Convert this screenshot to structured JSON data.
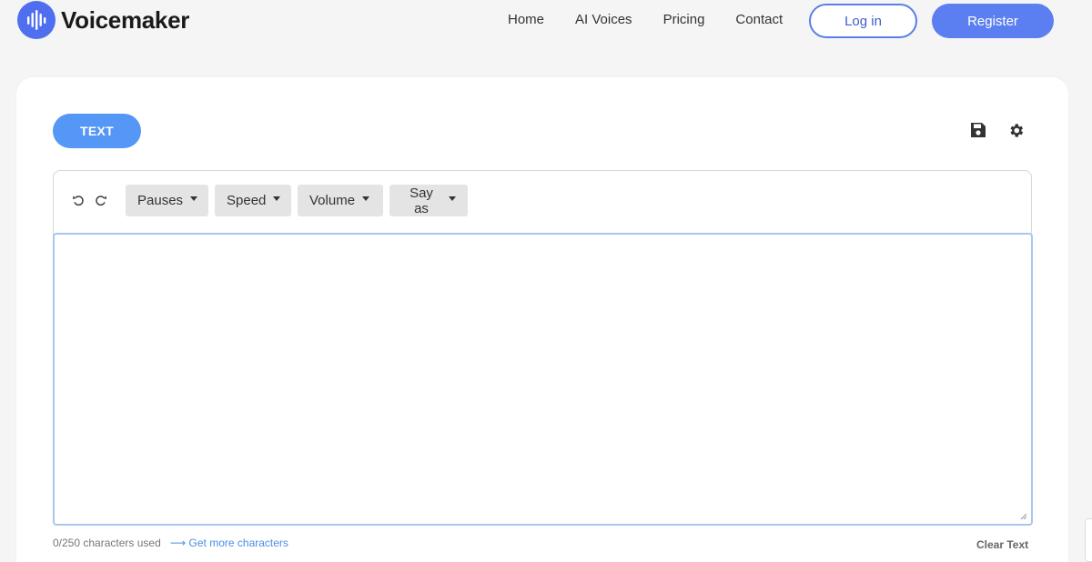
{
  "brand": {
    "name": "Voicemaker",
    "logo_icon": "soundwave-icon",
    "accent": "#4f6ff0"
  },
  "nav": {
    "items": [
      {
        "label": "Home"
      },
      {
        "label": "AI Voices"
      },
      {
        "label": "Pricing"
      },
      {
        "label": "Contact"
      }
    ],
    "login_label": "Log in",
    "register_label": "Register"
  },
  "editor": {
    "mode_tab_label": "TEXT",
    "save_icon": "floppy-disk-icon",
    "settings_icon": "gear-icon",
    "undo_icon": "undo-icon",
    "redo_icon": "redo-icon",
    "dropdowns": [
      {
        "label": "Pauses"
      },
      {
        "label": "Speed"
      },
      {
        "label": "Volume"
      },
      {
        "label": "Say as"
      }
    ],
    "text_value": "",
    "char_count": "0/250 characters used",
    "get_more_label": "Get more characters",
    "clear_label": "Clear Text"
  },
  "colors": {
    "primary_button": "#5b7ff0",
    "tab_active": "#5597f5",
    "link": "#4a8ee6",
    "focus_border": "#a8c6ef"
  }
}
